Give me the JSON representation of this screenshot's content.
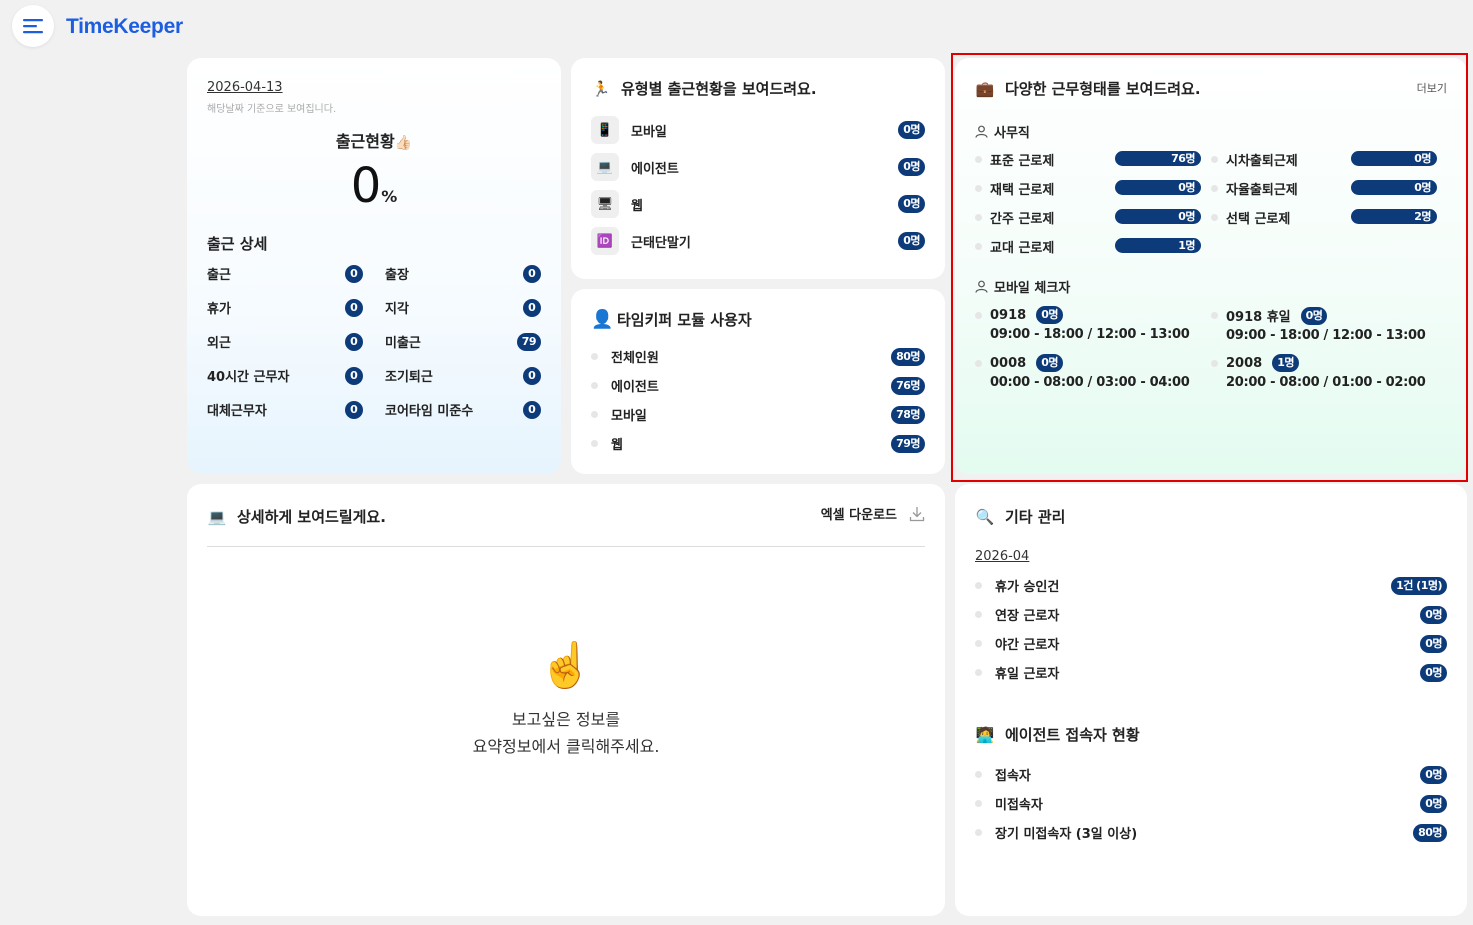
{
  "app": {
    "title": "TimeKeeper"
  },
  "attendance": {
    "date": "2026-04-13",
    "date_note": "해당날짜 기준으로 보여집니다.",
    "title": "출근현황",
    "title_emoji": "👍🏻",
    "percent": "0",
    "percent_unit": "%",
    "detail_title": "출근 상세",
    "items": [
      {
        "label": "출근",
        "value": "0"
      },
      {
        "label": "출장",
        "value": "0"
      },
      {
        "label": "휴가",
        "value": "0"
      },
      {
        "label": "지각",
        "value": "0"
      },
      {
        "label": "외근",
        "value": "0"
      },
      {
        "label": "미출근",
        "value": "79"
      },
      {
        "label": "40시간 근무자",
        "value": "0"
      },
      {
        "label": "조기퇴근",
        "value": "0"
      },
      {
        "label": "대체근무자",
        "value": "0"
      },
      {
        "label": "코어타임 미준수",
        "value": "0"
      }
    ]
  },
  "by_type": {
    "title": "유형별 출근현황을 보여드려요.",
    "items": [
      {
        "icon": "mobile-phone-icon",
        "glyph": "📱",
        "label": "모바일",
        "value": "0명"
      },
      {
        "icon": "laptop-icon",
        "glyph": "💻",
        "label": "에이전트",
        "value": "0명"
      },
      {
        "icon": "desktop-icon",
        "glyph": "🖥",
        "label": "웹",
        "value": "0명"
      },
      {
        "icon": "id-card-icon",
        "glyph": "🆔",
        "label": "근태단말기",
        "value": "0명"
      }
    ]
  },
  "module_users": {
    "title": "타임키퍼 모듈 사용자",
    "items": [
      {
        "label": "전체인원",
        "value": "80명"
      },
      {
        "label": "에이전트",
        "value": "76명"
      },
      {
        "label": "모바일",
        "value": "78명"
      },
      {
        "label": "웹",
        "value": "79명"
      }
    ]
  },
  "work_types": {
    "title": "다양한 근무형태를 보여드려요.",
    "more": "더보기",
    "office_label": "사무직",
    "office_items": [
      {
        "label": "표준 근로제",
        "value": "76명",
        "fill": 1.0
      },
      {
        "label": "시차출퇴근제",
        "value": "0명",
        "fill": 1.0
      },
      {
        "label": "재택 근로제",
        "value": "0명",
        "fill": 1.0
      },
      {
        "label": "자율출퇴근제",
        "value": "0명",
        "fill": 1.0
      },
      {
        "label": "간주 근로제",
        "value": "0명",
        "fill": 1.0
      },
      {
        "label": "선택 근로제",
        "value": "2명",
        "fill": 1.0
      },
      {
        "label": "교대 근로제",
        "value": "1명",
        "fill": 1.0
      }
    ],
    "mobile_label": "모바일 체크자",
    "mobile_items": [
      {
        "name": "0918",
        "count": "0명",
        "time": "09:00 - 18:00 / 12:00 - 13:00"
      },
      {
        "name": "0918 휴일",
        "count": "0명",
        "time": "09:00 - 18:00 / 12:00 - 13:00"
      },
      {
        "name": "0008",
        "count": "0명",
        "time": "00:00 - 08:00 / 03:00 - 04:00"
      },
      {
        "name": "2008",
        "count": "1명",
        "time": "20:00 - 08:00 / 01:00 - 02:00"
      }
    ]
  },
  "detail": {
    "title": "상세하게 보여드릴게요.",
    "download": "엑셀 다운로드",
    "empty_line1": "보고싶은 정보를",
    "empty_line2": "요약정보에서 클릭해주세요."
  },
  "other": {
    "title": "기타 관리",
    "month": "2026-04",
    "items": [
      {
        "label": "휴가 승인건",
        "value": "1건 (1명)"
      },
      {
        "label": "연장 근로자",
        "value": "0명"
      },
      {
        "label": "야간 근로자",
        "value": "0명"
      },
      {
        "label": "휴일 근로자",
        "value": "0명"
      }
    ],
    "agent_title": "에이전트 접속자 현황",
    "agent_items": [
      {
        "label": "접속자",
        "value": "0명"
      },
      {
        "label": "미접속자",
        "value": "0명"
      },
      {
        "label": "장기 미접속자 (3일 이상)",
        "value": "80명"
      }
    ]
  },
  "colors": {
    "accent": "#1d5ee0",
    "badge": "#0d3b7a",
    "highlight": "#e00000"
  }
}
